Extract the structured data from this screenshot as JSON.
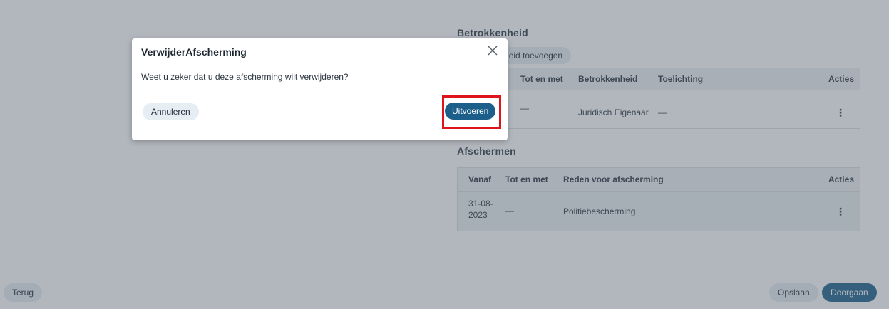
{
  "background": {
    "involvement": {
      "title": "Betrokkenheid",
      "add_button_label": "Betrokkenheid toevoegen",
      "columns": [
        "Tot en met",
        "Betrokkenheid",
        "Toelichting",
        "Acties"
      ],
      "rows": [
        {
          "tot_en_met": "—",
          "betrokkenheid": "Juridisch Eigenaar",
          "toelichting": "—"
        }
      ]
    },
    "shielding": {
      "title": "Afschermen",
      "columns": [
        "Vanaf",
        "Tot en met",
        "Reden voor afscherming",
        "Acties"
      ],
      "rows": [
        {
          "vanaf_line1": "31-08-",
          "vanaf_line2": "2023",
          "tot_en_met": "—",
          "reden": "Politiebescherming"
        }
      ]
    },
    "footer": {
      "back_label": "Terug",
      "save_label": "Opslaan",
      "next_label": "Doorgaan"
    }
  },
  "modal": {
    "title": "VerwijderAfscherming",
    "message": "Weet u zeker dat u deze afscherming wilt verwijderen?",
    "cancel_label": "Annuleren",
    "confirm_label": "Uitvoeren",
    "close_icon": "close-icon"
  },
  "colors": {
    "primary": "#1b5f8a",
    "secondary": "#e6edf3",
    "highlight": "#e0121b"
  }
}
